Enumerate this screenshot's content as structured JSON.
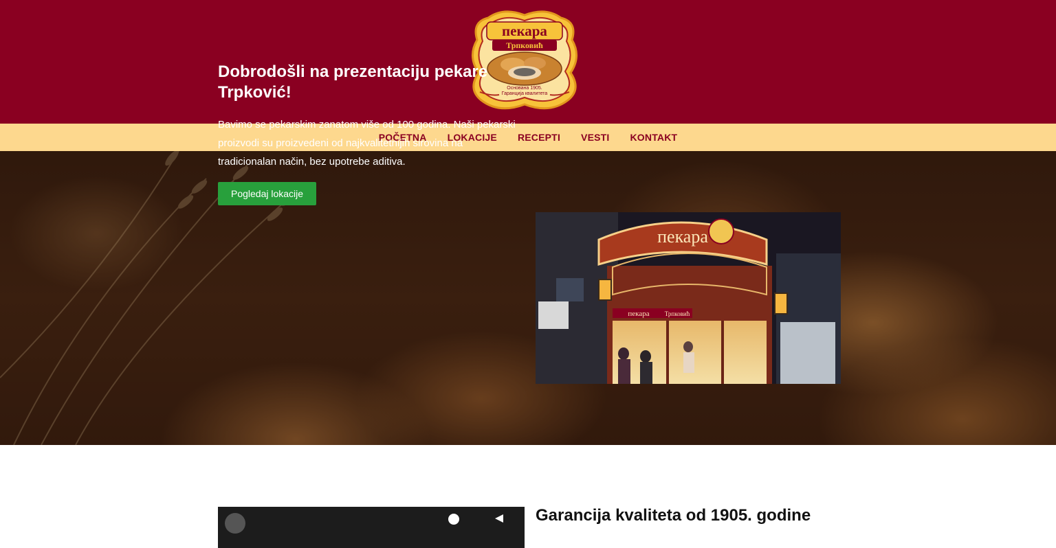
{
  "header": {
    "logo": {
      "icon": "pekara-trpkovic-logo",
      "title_line": "пекара",
      "name_line": "Трпковић",
      "tagline_1": "Основана 1905.",
      "tagline_2": "Гаранција квалитета"
    }
  },
  "nav": {
    "items": [
      {
        "label": "POČETNA"
      },
      {
        "label": "LOKACIJE"
      },
      {
        "label": "RECEPTI"
      },
      {
        "label": "VESTI"
      },
      {
        "label": "KONTAKT"
      }
    ]
  },
  "hero": {
    "title": "Dobrodošli na prezentaciju pekare Trpković!",
    "text": "Bavimo se pekarskim zanatom više od 100 godina. Naši pekarski proizvodi su proizvedeni od najkvalitetnijih sirovina na tradicionalan način, bez upotrebe aditiva.",
    "button_label": "Pogledaj lokacije",
    "photo": {
      "sign_text": "пекара",
      "sign_name": "Трпковић"
    }
  },
  "section2": {
    "title": "Garancija kvaliteta od 1905. godine"
  },
  "colors": {
    "header_bg": "#8a0021",
    "nav_bg": "#fdd88e",
    "nav_text": "#8a0021",
    "button_bg": "#28a03c"
  }
}
